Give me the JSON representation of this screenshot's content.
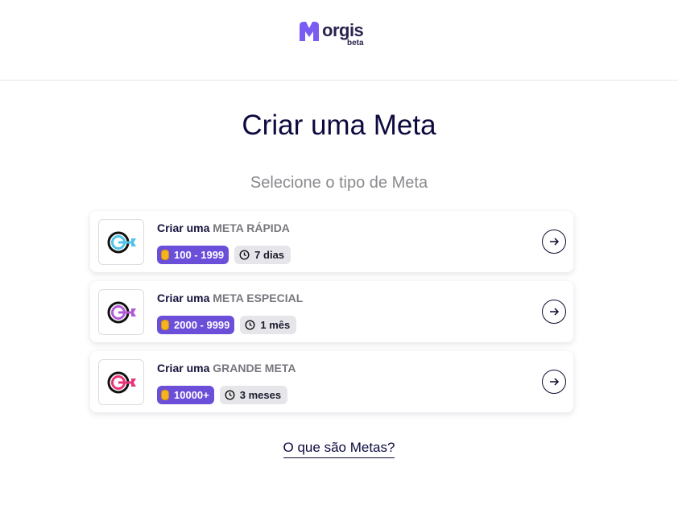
{
  "brand": {
    "name": "orgis",
    "tag": "beta",
    "color": "#7b5cf2"
  },
  "page": {
    "title": "Criar uma Meta",
    "subtitle": "Selecione o tipo de Meta"
  },
  "goals": [
    {
      "prefix": "Criar uma",
      "kind": "META RÁPIDA",
      "range": "100 - 1999",
      "duration": "7 dias",
      "accent": "#4fc3e8"
    },
    {
      "prefix": "Criar uma",
      "kind": "META ESPECIAL",
      "range": "2000 - 9999",
      "duration": "1 mês",
      "accent": "#b25ad6"
    },
    {
      "prefix": "Criar uma",
      "kind": "GRANDE META",
      "range": "10000+",
      "duration": "3 meses",
      "accent": "#e8337a"
    }
  ],
  "footer": {
    "link_label": "O que são Metas?"
  }
}
